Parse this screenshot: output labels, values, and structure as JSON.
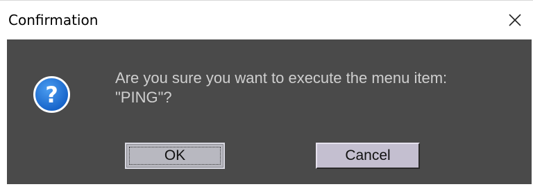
{
  "window": {
    "title": "Confirmation"
  },
  "dialog": {
    "icon": "question-icon",
    "message_line1": "Are you sure you want to execute the menu item:",
    "message_line2": "\"PING\"?",
    "ok_label": "OK",
    "cancel_label": "Cancel"
  },
  "colors": {
    "client_background": "#4a4a4a",
    "message_text": "#cfcfcf",
    "icon_blue": "#1a6fd6"
  }
}
